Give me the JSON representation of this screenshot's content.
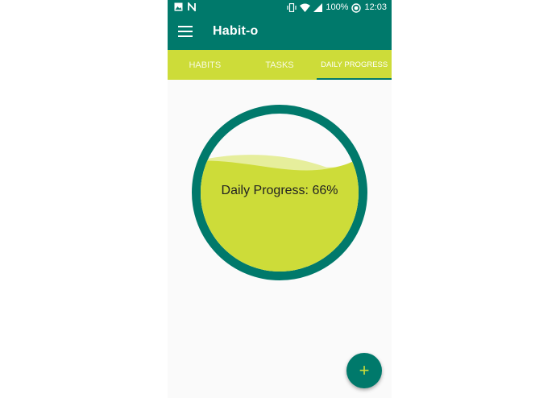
{
  "status_bar": {
    "battery": "100%",
    "time": "12:03",
    "icons": [
      "image-icon",
      "n-icon",
      "vibrate-icon",
      "wifi-icon",
      "signal-icon",
      "sync-icon"
    ]
  },
  "app_bar": {
    "title": "Habit-o",
    "menu_icon": "menu-icon"
  },
  "tabs": [
    {
      "label": "HABITS",
      "active": false
    },
    {
      "label": "TASKS",
      "active": false
    },
    {
      "label": "DAILY PROGRESS",
      "active": true
    }
  ],
  "progress": {
    "label": "Daily Progress: 66%",
    "value": 0.66
  },
  "fab": {
    "symbol": "+",
    "icon": "add-icon"
  },
  "colors": {
    "primary": "#00796b",
    "accent": "#cddc39",
    "wave_light": "#e6ee9c",
    "background": "#fafafa"
  }
}
